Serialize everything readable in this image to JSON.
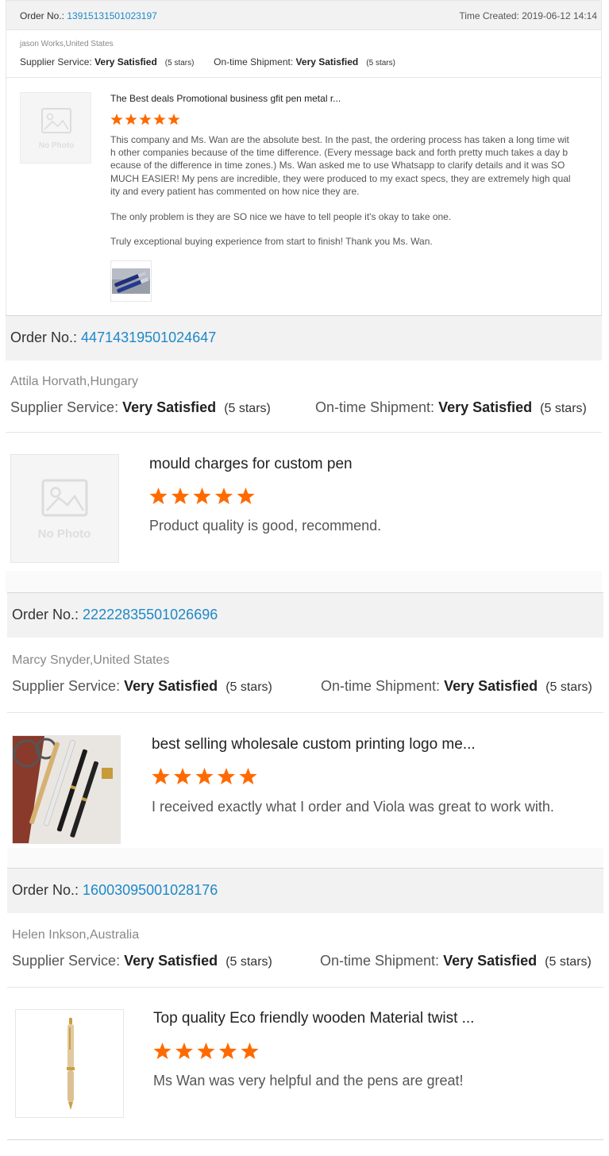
{
  "order_prefix": "Order No.:",
  "time_prefix": "Time Created:",
  "supplier_service_label": "Supplier Service:",
  "shipment_label": "On-time Shipment:",
  "star_color": "#ff6a00",
  "link_color": "#1e88c8",
  "reviews": [
    {
      "order_no": "13915131501023197",
      "time_created": "2019-06-12 14:14",
      "buyer": "jason Works,United States",
      "supplier_service": "Very Satisfied",
      "supplier_stars": "(5 stars)",
      "shipment": "Very Satisfied",
      "shipment_stars": "(5 stars)",
      "product_title": "The Best deals Promotional business gfit pen metal r...",
      "rating": 5,
      "thumbnail": "No Photo",
      "paragraphs": [
        "This company and Ms. Wan are the absolute best. In the past, the ordering process has taken a long time with other companies because of the time difference. (Every message back and forth pretty much takes a day because of the difference in time zones.) Ms. Wan asked me to use Whatsapp to clarify details and it was SO MUCH EASIER! My pens are incredible, they were produced to my exact specs, they are extremely high quality and every patient has commented on how nice they are.",
        "The only problem is they are SO nice we have to tell people it's okay to take one.",
        "Truly exceptional buying experience from start to finish! Thank you Ms. Wan."
      ]
    },
    {
      "order_no": "44714319501024647",
      "buyer": "Attila Horvath,Hungary",
      "supplier_service": "Very Satisfied",
      "supplier_stars": "(5 stars)",
      "shipment": "Very Satisfied",
      "shipment_stars": "(5 stars)",
      "product_title": "mould charges for custom pen",
      "rating": 5,
      "thumbnail": "No Photo",
      "text": "Product quality is good, recommend."
    },
    {
      "order_no": "22222835501026696",
      "buyer": "Marcy Snyder,United States",
      "supplier_service": "Very Satisfied",
      "supplier_stars": "(5 stars)",
      "shipment": "Very Satisfied",
      "shipment_stars": "(5 stars)",
      "product_title": "best selling wholesale custom printing logo me...",
      "rating": 5,
      "text": "I received exactly what I order and Viola was great to work with."
    },
    {
      "order_no": "16003095001028176",
      "buyer": "Helen Inkson,Australia",
      "supplier_service": "Very Satisfied",
      "supplier_stars": "(5 stars)",
      "shipment": "Very Satisfied",
      "shipment_stars": "(5 stars)",
      "product_title": "Top quality Eco friendly wooden Material twist ...",
      "rating": 5,
      "text": "Ms Wan was very helpful and the pens are great!"
    }
  ]
}
